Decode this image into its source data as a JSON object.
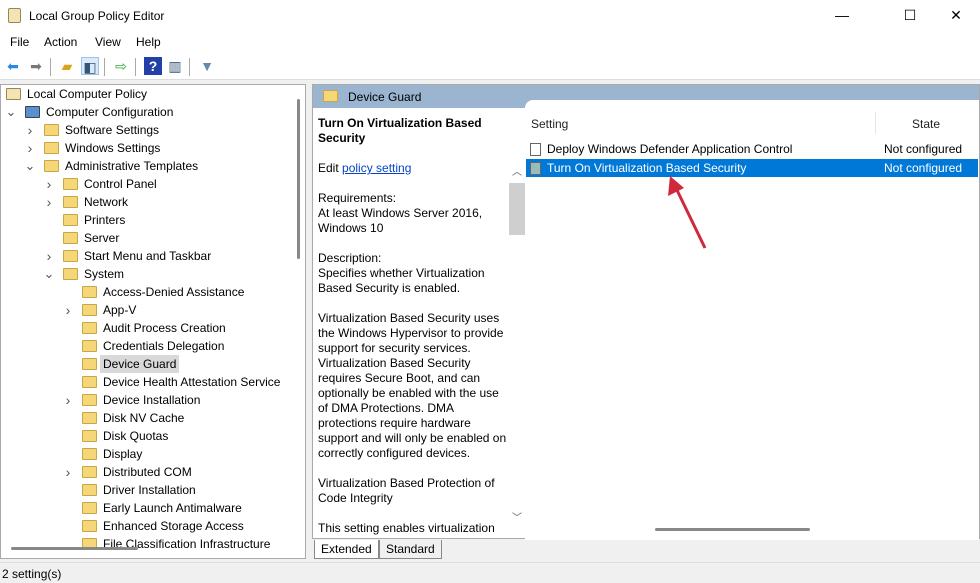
{
  "window": {
    "title": "Local Group Policy Editor",
    "minimize": "—",
    "maximize": "☐",
    "close": "✕"
  },
  "menu": [
    "File",
    "Action",
    "View",
    "Help"
  ],
  "toolbar": [
    "back-icon",
    "forward-icon",
    "up-folder-icon",
    "show-hide-tree-icon",
    "export-list-icon",
    "help-icon",
    "show-hide-action-pane-icon",
    "filter-icon"
  ],
  "tree": [
    {
      "label": "Local Computer Policy",
      "level": 0,
      "exp": ""
    },
    {
      "label": "Computer Configuration",
      "level": 1,
      "exp": "open"
    },
    {
      "label": "Software Settings",
      "level": 2,
      "exp": "closed"
    },
    {
      "label": "Windows Settings",
      "level": 2,
      "exp": "closed"
    },
    {
      "label": "Administrative Templates",
      "level": 2,
      "exp": "open"
    },
    {
      "label": "Control Panel",
      "level": 3,
      "exp": "closed"
    },
    {
      "label": "Network",
      "level": 3,
      "exp": "closed"
    },
    {
      "label": "Printers",
      "level": 3,
      "exp": ""
    },
    {
      "label": "Server",
      "level": 3,
      "exp": ""
    },
    {
      "label": "Start Menu and Taskbar",
      "level": 3,
      "exp": "closed"
    },
    {
      "label": "System",
      "level": 3,
      "exp": "open"
    },
    {
      "label": "Access-Denied Assistance",
      "level": 4,
      "exp": ""
    },
    {
      "label": "App-V",
      "level": 4,
      "exp": "closed"
    },
    {
      "label": "Audit Process Creation",
      "level": 4,
      "exp": ""
    },
    {
      "label": "Credentials Delegation",
      "level": 4,
      "exp": ""
    },
    {
      "label": "Device Guard",
      "level": 4,
      "exp": "",
      "selected": true
    },
    {
      "label": "Device Health Attestation Service",
      "level": 4,
      "exp": ""
    },
    {
      "label": "Device Installation",
      "level": 4,
      "exp": "closed"
    },
    {
      "label": "Disk NV Cache",
      "level": 4,
      "exp": ""
    },
    {
      "label": "Disk Quotas",
      "level": 4,
      "exp": ""
    },
    {
      "label": "Display",
      "level": 4,
      "exp": ""
    },
    {
      "label": "Distributed COM",
      "level": 4,
      "exp": "closed"
    },
    {
      "label": "Driver Installation",
      "level": 4,
      "exp": ""
    },
    {
      "label": "Early Launch Antimalware",
      "level": 4,
      "exp": ""
    },
    {
      "label": "Enhanced Storage Access",
      "level": 4,
      "exp": ""
    },
    {
      "label": "File Classification Infrastructure",
      "level": 4,
      "exp": ""
    }
  ],
  "pane": {
    "header": "Device Guard",
    "desc_title": "Turn On Virtualization Based Security",
    "edit_prefix": "Edit ",
    "edit_link": "policy setting",
    "requirements_label": "Requirements:",
    "requirements": "At least Windows Server 2016, Windows 10",
    "description_label": "Description:",
    "description": "Specifies whether Virtualization Based Security is enabled.",
    "para1": "Virtualization Based Security uses the Windows Hypervisor to provide support for security services. Virtualization Based Security requires Secure Boot, and can optionally be enabled with the use of DMA Protections. DMA protections require hardware support and will only be enabled on correctly configured devices.",
    "para2": "Virtualization Based Protection of Code Integrity",
    "para3": "This setting enables virtualization"
  },
  "list": {
    "columns": [
      "Setting",
      "State"
    ],
    "rows": [
      {
        "setting": "Deploy Windows Defender Application Control",
        "state": "Not configured"
      },
      {
        "setting": "Turn On Virtualization Based Security",
        "state": "Not configured",
        "selected": true
      }
    ]
  },
  "tabs": [
    "Extended",
    "Standard"
  ],
  "status": "2 setting(s)",
  "colors": {
    "selection": "#0078d7",
    "header": "#9bb4cf",
    "arrow": "#d0283c"
  }
}
